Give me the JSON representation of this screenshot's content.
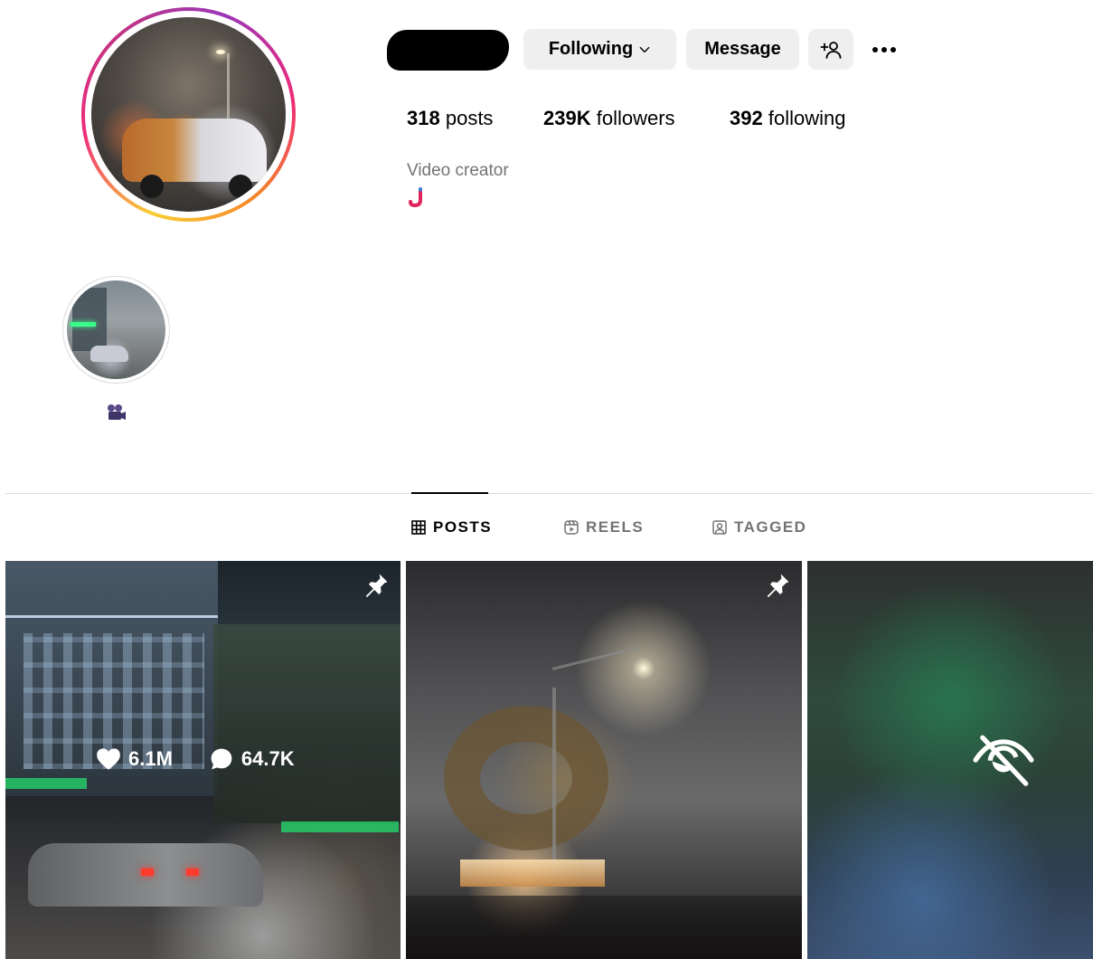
{
  "profile": {
    "stats": {
      "posts_count": "318",
      "posts_label": "posts",
      "followers_count": "239K",
      "followers_label": "followers",
      "following_count": "392",
      "following_label": "following"
    },
    "bio": {
      "category": "Video creator",
      "emoji": "hook-emoji"
    }
  },
  "actions": {
    "following_label": "Following",
    "message_label": "Message",
    "add_user_icon": "add-user-icon",
    "more_icon": "more-options-icon"
  },
  "highlights": [
    {
      "label_icon": "film-camera-emoji"
    }
  ],
  "tabs": [
    {
      "label": "POSTS",
      "icon": "grid-icon",
      "active": true
    },
    {
      "label": "REELS",
      "icon": "reels-icon",
      "active": false
    },
    {
      "label": "TAGGED",
      "icon": "tagged-icon",
      "active": false
    }
  ],
  "posts": [
    {
      "pinned": true,
      "hovered": true,
      "likes": "6.1M",
      "comments": "64.7K"
    },
    {
      "pinned": true,
      "hovered": false
    },
    {
      "hidden": true,
      "icon": "eye-off-icon"
    }
  ],
  "colors": {
    "button_bg": "#efefef",
    "secondary_text": "#737373",
    "divider": "#dbdbdb",
    "story_ring_start": "#f9ce34",
    "story_ring_end": "#c13584"
  }
}
